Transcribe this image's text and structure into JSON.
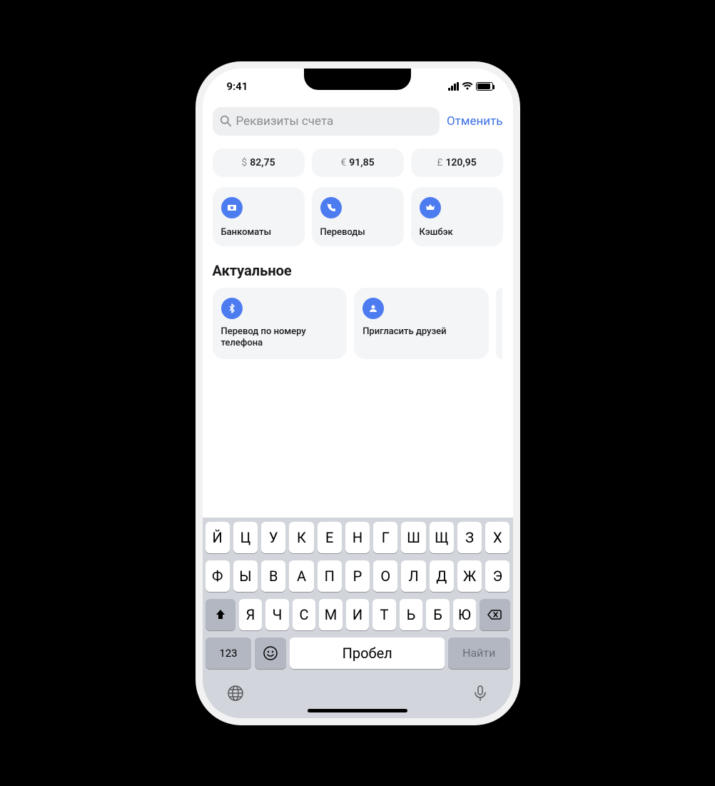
{
  "status": {
    "time": "9:41"
  },
  "search": {
    "placeholder": "Реквизиты счета",
    "cancel": "Отменить"
  },
  "rates": [
    {
      "symbol": "$",
      "value": "82,75"
    },
    {
      "symbol": "€",
      "value": "91,85"
    },
    {
      "symbol": "£",
      "value": "120,95"
    }
  ],
  "tiles": [
    {
      "label": "Банкоматы",
      "icon": "cash-icon"
    },
    {
      "label": "Переводы",
      "icon": "phone-icon"
    },
    {
      "label": "Кэшбэк",
      "icon": "crown-icon"
    }
  ],
  "section": {
    "title": "Актуальное"
  },
  "features": [
    {
      "label": "Перевод по номеру телефона",
      "icon": "bluetooth-icon"
    },
    {
      "label": "Пригласить друзей",
      "icon": "person-add-icon"
    }
  ],
  "keyboard": {
    "row1": [
      "Й",
      "Ц",
      "У",
      "К",
      "Е",
      "Н",
      "Г",
      "Ш",
      "Щ",
      "З",
      "Х"
    ],
    "row2": [
      "Ф",
      "Ы",
      "В",
      "А",
      "П",
      "Р",
      "О",
      "Л",
      "Д",
      "Ж",
      "Э"
    ],
    "row3": [
      "Я",
      "Ч",
      "С",
      "М",
      "И",
      "Т",
      "Ь",
      "Б",
      "Ю"
    ],
    "numeric": "123",
    "space": "Пробел",
    "enter": "Найти"
  }
}
